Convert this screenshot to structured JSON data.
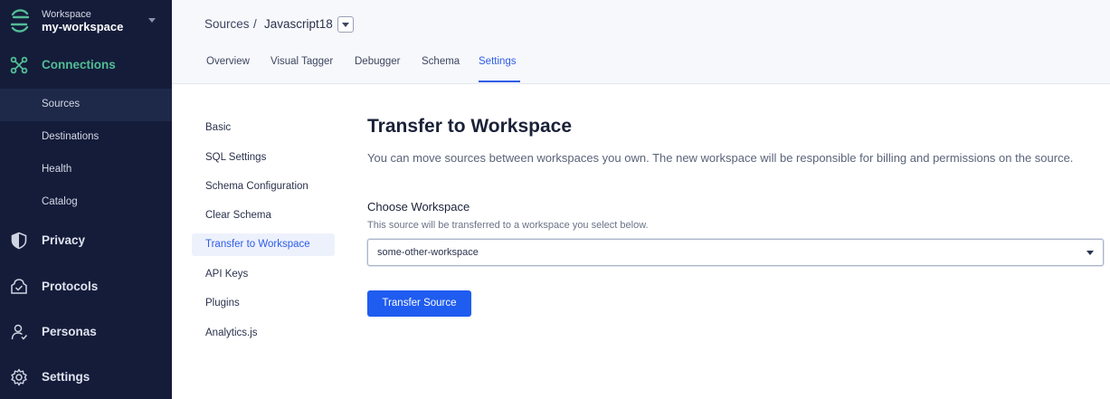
{
  "workspace": {
    "label": "Workspace",
    "name": "my-workspace"
  },
  "sidebar": {
    "connections": "Connections",
    "sub_items": [
      "Sources",
      "Destinations",
      "Health",
      "Catalog"
    ],
    "privacy": "Privacy",
    "protocols": "Protocols",
    "personas": "Personas",
    "settings": "Settings"
  },
  "breadcrumb": {
    "root": "Sources",
    "separator": "/",
    "current": "Javascript18"
  },
  "tabs": [
    "Overview",
    "Visual Tagger",
    "Debugger",
    "Schema",
    "Settings"
  ],
  "settings_menu": [
    "Basic",
    "SQL Settings",
    "Schema Configuration",
    "Clear Schema",
    "Transfer to Workspace",
    "API Keys",
    "Plugins",
    "Analytics.js"
  ],
  "content": {
    "title": "Transfer to Workspace",
    "description": "You can move sources between workspaces you own. The new workspace will be responsible for billing and permissions on the source.",
    "field_label": "Choose Workspace",
    "field_help": "This source will be transferred to a workspace you select below.",
    "selected_workspace": "some-other-workspace",
    "button": "Transfer Source"
  },
  "colors": {
    "sidebar_bg": "#141c3a",
    "accent": "#2f5ce8",
    "connections_green": "#52bd94",
    "button": "#1f5cf0"
  },
  "icons": [
    "segment-logo-icon",
    "connections-icon",
    "shield-icon",
    "protocols-icon",
    "personas-icon",
    "gear-icon",
    "chevron-down-icon"
  ]
}
